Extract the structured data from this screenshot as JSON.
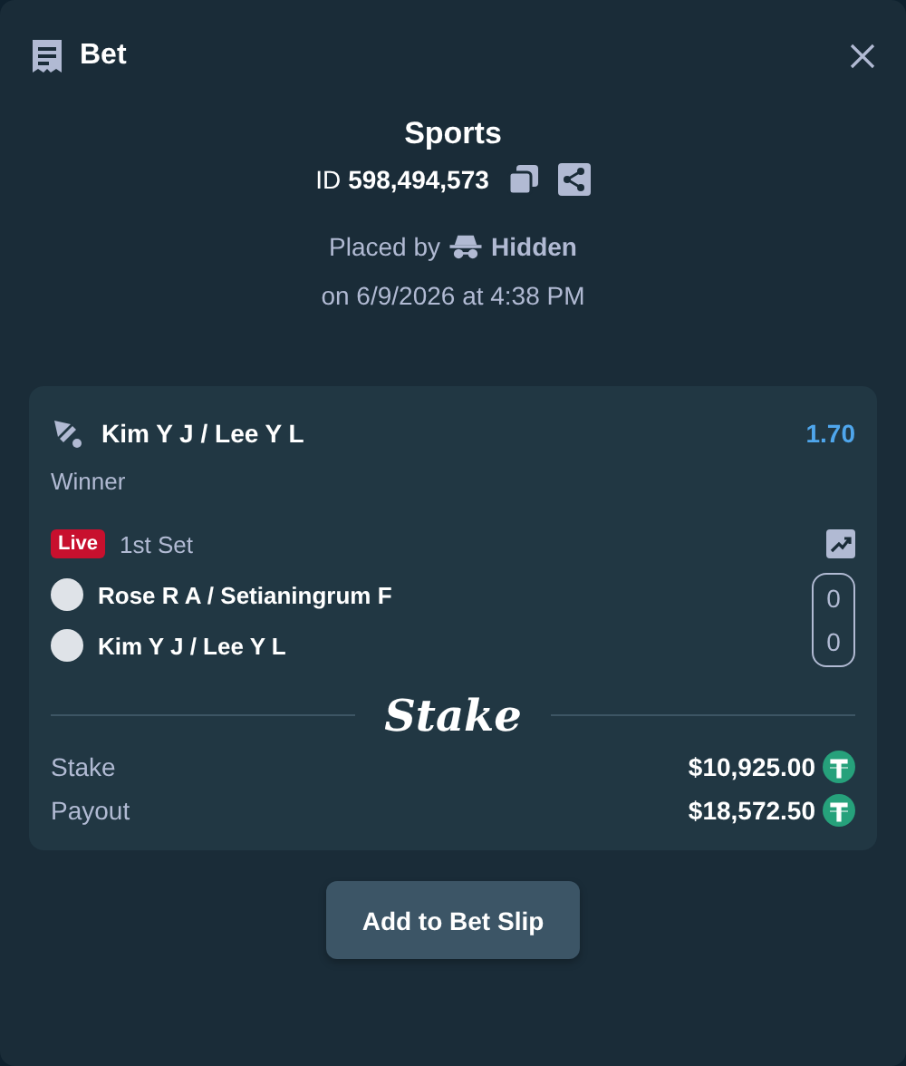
{
  "header": {
    "title": "Bet"
  },
  "summary": {
    "category": "Sports",
    "id_label": "ID",
    "id_value": "598,494,573",
    "placed_by_label": "Placed by",
    "placed_by_user": "Hidden",
    "placed_on": "on 6/9/2026 at 4:38 PM"
  },
  "bet": {
    "selection": "Kim Y J / Lee Y L",
    "odds": "1.70",
    "market": "Winner",
    "live": true,
    "live_label": "Live",
    "period": "1st Set",
    "teams": [
      {
        "name": "Rose R A / Setianingrum F",
        "score": "0"
      },
      {
        "name": "Kim Y J / Lee Y L",
        "score": "0"
      }
    ],
    "logo": "Stake",
    "totals": [
      {
        "label": "Stake",
        "amount": "$10,925.00"
      },
      {
        "label": "Payout",
        "amount": "$18,572.50"
      }
    ]
  },
  "action": {
    "label": "Add to Bet Slip"
  }
}
